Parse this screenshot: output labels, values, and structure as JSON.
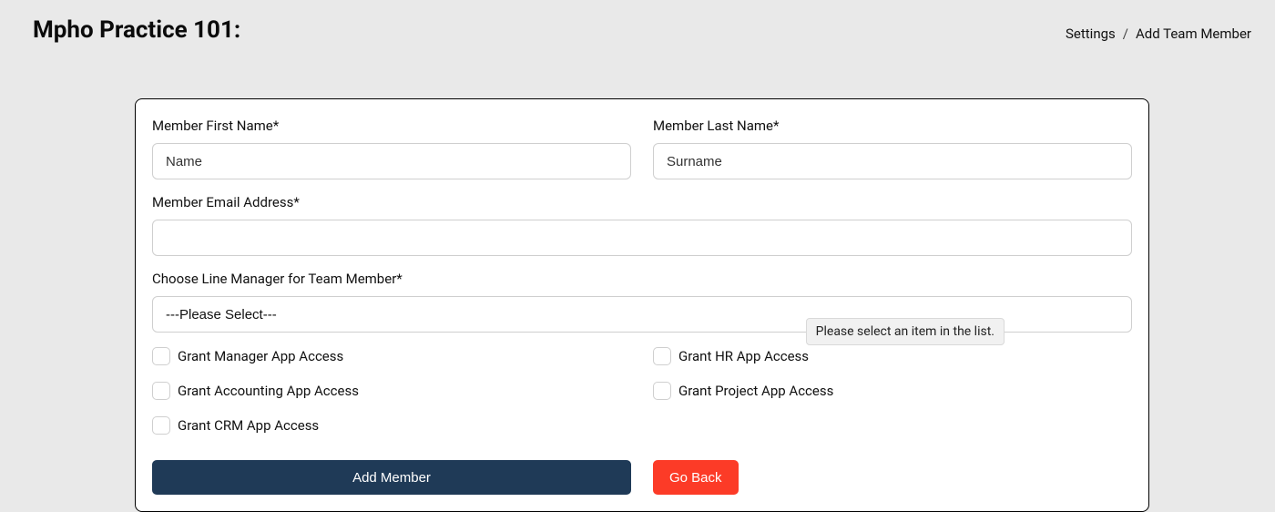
{
  "header": {
    "title": "Mpho Practice 101:",
    "breadcrumb": {
      "settings": "Settings",
      "current": "Add Team Member"
    }
  },
  "form": {
    "first_name": {
      "label": "Member First Name*",
      "placeholder": "Name",
      "value": ""
    },
    "last_name": {
      "label": "Member Last Name*",
      "placeholder": "Surname",
      "value": ""
    },
    "email": {
      "label": "Member Email Address*",
      "placeholder": "",
      "value": ""
    },
    "line_manager": {
      "label": "Choose Line Manager for Team Member*",
      "selected": "---Please Select---"
    },
    "checkboxes": {
      "manager": "Grant Manager App Access",
      "hr": "Grant HR App Access",
      "accounting": "Grant Accounting App Access",
      "project": "Grant Project App Access",
      "crm": "Grant CRM App Access"
    },
    "buttons": {
      "add": "Add Member",
      "back": "Go Back"
    }
  },
  "tooltip": "Please select an item in the list."
}
